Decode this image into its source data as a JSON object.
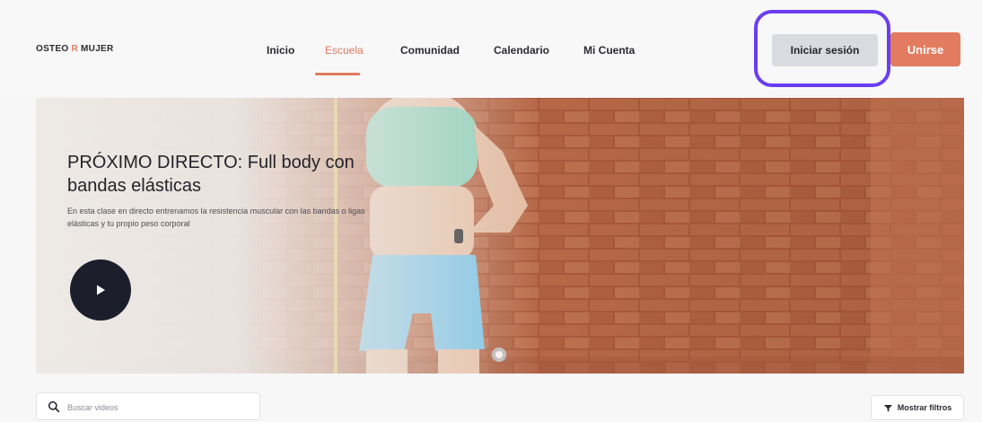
{
  "header": {
    "logo": {
      "left": "OSTEO",
      "mark": "R",
      "right": "MUJER"
    },
    "nav": [
      {
        "label": "Inicio",
        "active": false
      },
      {
        "label": "Escuela",
        "active": true
      },
      {
        "label": "Comunidad",
        "active": false
      },
      {
        "label": "Calendario",
        "active": false
      },
      {
        "label": "Mi Cuenta",
        "active": false
      }
    ],
    "login_label": "Iniciar sesión",
    "join_label": "Unirse"
  },
  "hero": {
    "title": "PRÓXIMO DIRECTO: Full body con bandas elásticas",
    "description": "En esta clase en directo entrenamos la resistencia muscular con las bandas o ligas elásticas y tu propio peso corporal"
  },
  "search": {
    "placeholder": "Buscar videos"
  },
  "filters": {
    "label": "Mostrar filtros"
  },
  "colors": {
    "accent": "#e07a5f",
    "focus_ring": "#6b3df2",
    "login_bg": "#d9dbe0",
    "play_bg": "#1c1f2b"
  },
  "icons": {
    "play": "play-icon",
    "search": "search-icon",
    "filter": "filter-icon"
  }
}
